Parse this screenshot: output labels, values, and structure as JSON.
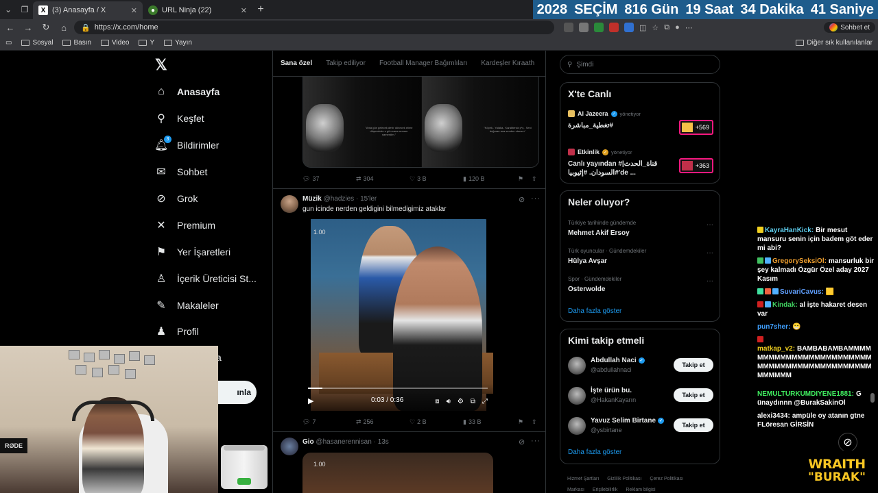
{
  "browser": {
    "tabs": [
      {
        "title": "(3) Anasayfa / X",
        "active": true,
        "icon": "x-logo-icon"
      },
      {
        "title": "URL Ninja (22)",
        "active": false,
        "icon": "ninja-icon"
      }
    ],
    "url": "https://x.com/home",
    "chat_button": "Sohbet et",
    "bookmarks": [
      "Sosyal",
      "Basın",
      "Video",
      "Y",
      "Yayın"
    ],
    "other_bookmarks": "Diğer sık kullanılanlar"
  },
  "countdown": {
    "year": "2028",
    "label": "SEÇİM",
    "days": "816 Gün",
    "hours": "19 Saat",
    "minutes": "34 Dakika",
    "seconds": "41 Saniye",
    "bg_color": "#1e5c8c"
  },
  "nav": {
    "items": [
      {
        "label": "Anasayfa",
        "icon": "home-icon"
      },
      {
        "label": "Keşfet",
        "icon": "search-icon"
      },
      {
        "label": "Bildirimler",
        "icon": "bell-icon",
        "badge": "3"
      },
      {
        "label": "Sohbet",
        "icon": "mail-icon"
      },
      {
        "label": "Grok",
        "icon": "grok-icon"
      },
      {
        "label": "Premium",
        "icon": "x-logo-icon"
      },
      {
        "label": "Yer İşaretleri",
        "icon": "bookmark-icon"
      },
      {
        "label": "İçerik Üreticisi St...",
        "icon": "creator-icon"
      },
      {
        "label": "Makaleler",
        "icon": "article-icon"
      },
      {
        "label": "Profil",
        "icon": "person-icon"
      }
    ],
    "post_button_partial": "ınla",
    "partial_label": "a"
  },
  "timeline": {
    "tabs": [
      "Sana özel",
      "Takip ediliyor",
      "Football Manager Bağımlıları",
      "Kardeşler Kıraath"
    ],
    "tweet1": {
      "quote_left": "\"Ama gün gelecek devir dönecek elime düşeceksin o gün sana acısam namerdim.\"",
      "quote_right": "\"Köpek.. Yalaka.. Karaktersiz p*ç.. Seni doğuran ana senden utansın\"",
      "replies": "37",
      "reposts": "304",
      "likes": "3 B",
      "views": "120 B"
    },
    "tweet2": {
      "name": "Müzik",
      "handle": "@hadzies",
      "time": "15'ler",
      "text": "gun icinde nerden geldigini bilmedigimiz ataklar",
      "video_badge": "1.00",
      "video_time": "0:03 / 0:36",
      "progress": 0.08,
      "replies": "7",
      "reposts": "256",
      "likes": "2 B",
      "views": "33 B"
    },
    "tweet3": {
      "name": "Gio",
      "handle": "@hasanerennisan",
      "time": "13s",
      "video_badge": "1.00"
    }
  },
  "sidebar": {
    "search_placeholder": "Şimdi",
    "live": {
      "title": "X'te Canlı",
      "items": [
        {
          "host": "Al Jazeera",
          "suffix": "yönetiyor",
          "text": "تغطية_مباشرة#",
          "count": "+569"
        },
        {
          "host": "Etkinlik",
          "suffix": "yönetiyor",
          "text": "Canlı yayından #|قناة_الحدث السودان. #إثيوبيا#'de ...",
          "count": "+363"
        }
      ]
    },
    "trends": {
      "title": "Neler oluyor?",
      "items": [
        {
          "context": "Türkiye tarihinde gündemde",
          "topic": "Mehmet Akif Ersoy"
        },
        {
          "context": "Türk oyuncular · Gündemdekiler",
          "topic": "Hülya Avşar"
        },
        {
          "context": "Spor · Gündemdekiler",
          "topic": "Osterwolde"
        }
      ],
      "show_more": "Daha fazla göster"
    },
    "who_to_follow": {
      "title": "Kimi takip etmeli",
      "items": [
        {
          "name": "Abdullah Naci",
          "handle": "@abdullahnaci",
          "verified": true,
          "button": "Takip et"
        },
        {
          "name": "İşte ürün bu.",
          "handle": "@HakanKayarın",
          "verified": false,
          "button": "Takip et"
        },
        {
          "name": "Yavuz Selim Birtane",
          "handle": "@ysbirtane",
          "verified": true,
          "button": "Takip et"
        }
      ],
      "show_more": "Daha fazla göster"
    },
    "footer": [
      "Hizmet Şartları",
      "Gizlilik Politikası",
      "Çerez Politikası",
      "Markası",
      "Erişilebilirlik",
      "Reklam bilgisi"
    ]
  },
  "chat": {
    "messages": [
      {
        "user": "KayraHanKick:",
        "color": "#5fd0f0",
        "text": "Bir mesut mansuru senin için badem göt eder mi abi?"
      },
      {
        "user": "GregorySeksiOl:",
        "color": "#f0a030",
        "text": "mansurluk bir şey kalmadı Özgür Özel aday 2027 Kasım"
      },
      {
        "user": "SuvariCavus:",
        "color": "#60a0ff",
        "text": "🟨"
      },
      {
        "user": "Kindak:",
        "color": "#40d060",
        "text": "al işte hakaret desen var"
      },
      {
        "user": "pun7sher:",
        "color": "#40a0ff",
        "text": "😁"
      },
      {
        "user": "matkap_v2:",
        "color": "#f0d020",
        "text": "BAMBABAMBAMMMMMMMMMMMMMMMMMMMMMMMMMMMMMMMMMMMMMMMMMMMMMMMMMM"
      },
      {
        "user": "NEMULTURKUMDIYENE1881:",
        "color": "#40f060",
        "text": "G ünaydınnn @BurakSakinOl"
      },
      {
        "user": "alexi3434:",
        "color": "#ffffff",
        "text": "ampüle oy atanın gtne FLöresan GİRSİN"
      }
    ]
  },
  "stream": {
    "brand_line1": "WRAITH",
    "brand_line2": "\"BURAK\"",
    "mic_label": "RØDE",
    "brand_color": "#f7c623"
  }
}
